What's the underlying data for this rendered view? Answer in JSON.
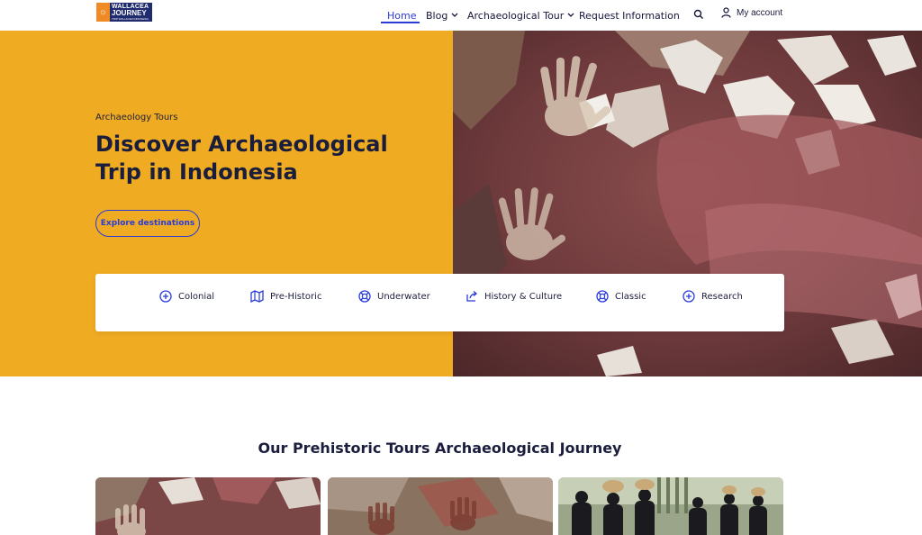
{
  "brand": {
    "line1": "WALLACEA",
    "line2": "JOURNEY",
    "line3": "TRIP WALLACEA INDONESIA"
  },
  "nav": {
    "home": "Home",
    "blog": "Blog",
    "archaeological_tour": "Archaeological Tour",
    "request_information": "Request Information",
    "my_account": "My account",
    "chevron": "⌄"
  },
  "hero": {
    "eyebrow": "Archaeology Tours",
    "title": "Discover Archaeological Trip in Indonesia",
    "cta": "Explore destinations",
    "background_color": "#efab22"
  },
  "categories": [
    {
      "label": "Colonial",
      "icon": "plus-circle-icon"
    },
    {
      "label": "Pre-Historic",
      "icon": "map-icon"
    },
    {
      "label": "Underwater",
      "icon": "lifebuoy-icon"
    },
    {
      "label": "History & Culture",
      "icon": "share-arrow-icon"
    },
    {
      "label": "Classic",
      "icon": "lifebuoy-icon"
    },
    {
      "label": "Research",
      "icon": "plus-circle-icon"
    }
  ],
  "section": {
    "title": "Our Prehistoric Tours Archaeological Journey"
  },
  "colors": {
    "accent": "#2a3bd8",
    "text": "#1b1d3c"
  }
}
